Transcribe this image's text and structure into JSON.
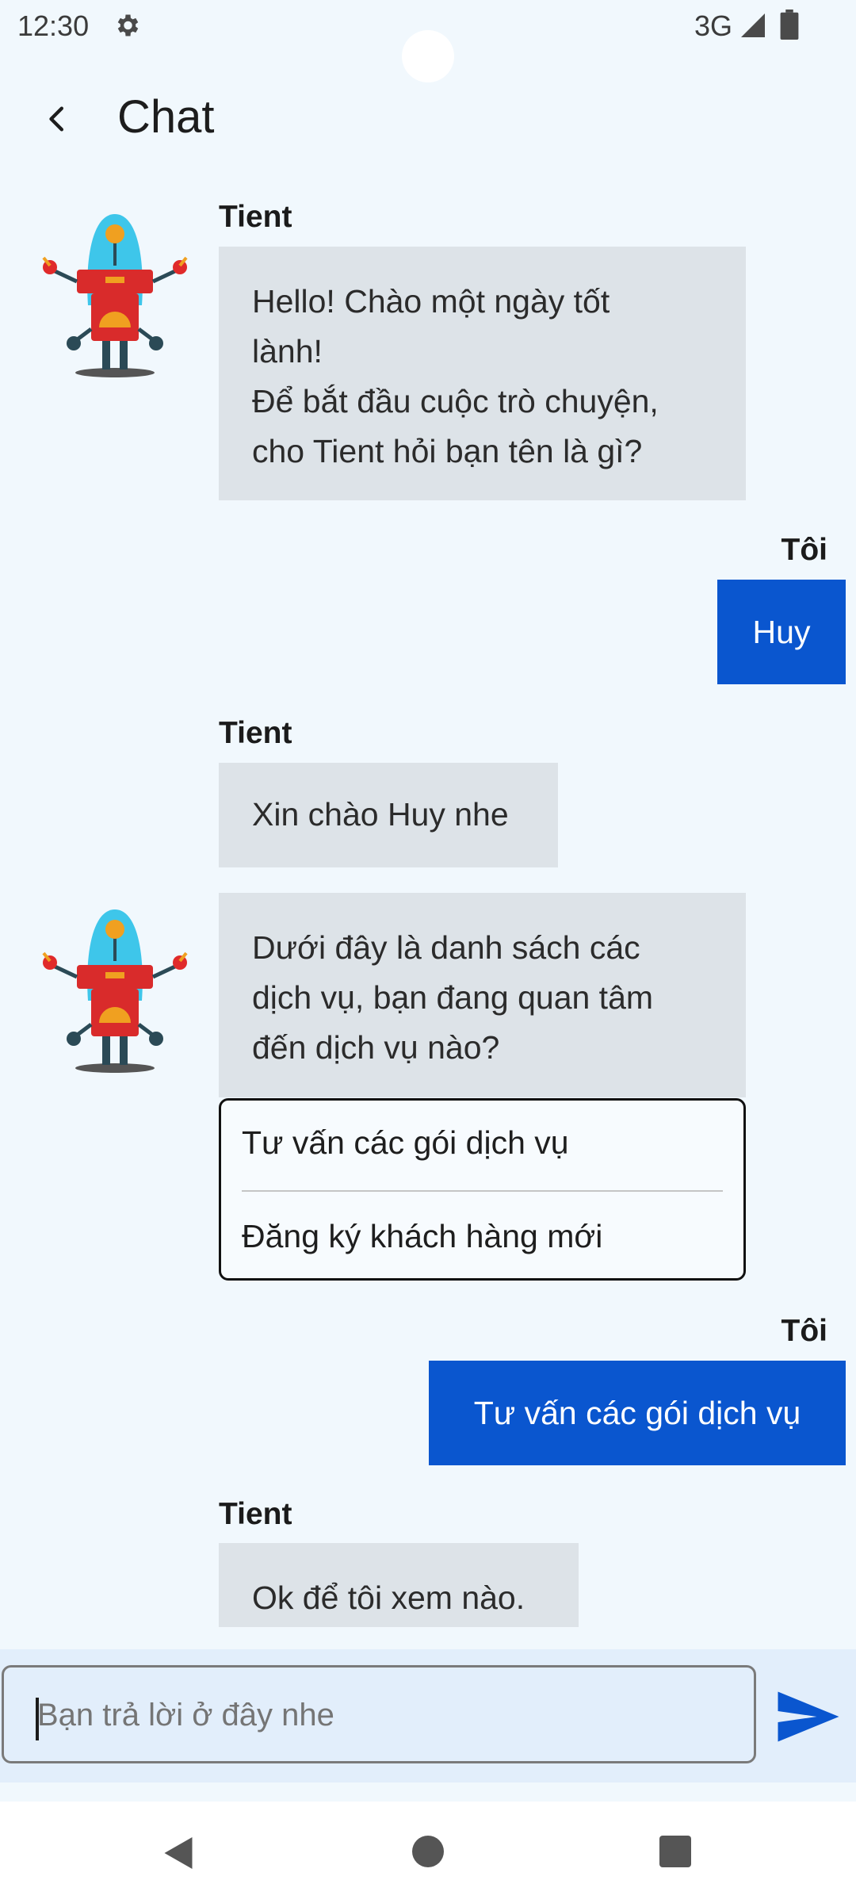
{
  "status_bar": {
    "time": "12:30",
    "network": "3G",
    "icons": [
      "gear-icon",
      "signal-icon",
      "battery-icon"
    ]
  },
  "app_bar": {
    "title": "Chat",
    "back_icon": "chevron-left-icon"
  },
  "colors": {
    "background": "#f1f8fd",
    "bot_bubble": "#dde3e8",
    "user_bubble": "#0a56cf",
    "input_area": "#e2eefb",
    "send_icon": "#0a56cf"
  },
  "messages": [
    {
      "sender": "Tient",
      "lines": [
        "Hello! Chào một ngày tốt",
        "lành!",
        "Để bắt đầu cuộc trò chuyện,",
        "cho Tient hỏi bạn tên là gì?"
      ]
    },
    {
      "sender": "Tôi",
      "text": "Huy"
    },
    {
      "sender": "Tient",
      "text": "Xin chào Huy nhe"
    },
    {
      "lines": [
        "Dưới đây là danh sách các",
        "dịch vụ, bạn đang quan tâm",
        "đến dịch vụ nào?"
      ]
    },
    {
      "sender": "Tôi",
      "text": "Tư vấn các gói dịch vụ"
    },
    {
      "sender": "Tient",
      "text": "Ok để tôi xem nào."
    }
  ],
  "options": [
    "Tư vấn các gói dịch vụ",
    "Đăng ký khách hàng mới"
  ],
  "input": {
    "placeholder": "Bạn trả lời ở đây nhe",
    "value": ""
  },
  "nav_bar": {
    "icons": [
      "back-triangle-icon",
      "home-circle-icon",
      "recents-square-icon"
    ]
  }
}
